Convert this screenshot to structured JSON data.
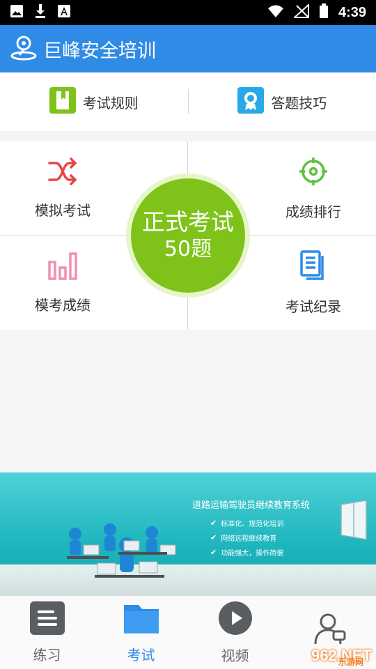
{
  "status_bar": {
    "time": "4:39",
    "icons": [
      "image-icon",
      "download-icon",
      "font-icon",
      "wifi-icon",
      "signal-off-icon",
      "battery-icon"
    ]
  },
  "app": {
    "title": "巨峰安全培训",
    "logo_icon": "location-person-icon",
    "accent_color": "#2f8be6"
  },
  "top_menu": [
    {
      "label": "考试规则",
      "icon": "book-icon",
      "color": "#7fc31a"
    },
    {
      "label": "答题技巧",
      "icon": "award-icon",
      "color": "#29a8e8"
    }
  ],
  "grid": [
    {
      "label": "模拟考试",
      "icon": "shuffle-icon",
      "color": "#e64545"
    },
    {
      "label": "成绩排行",
      "icon": "target-icon",
      "color": "#5cc23f"
    },
    {
      "label": "模考成绩",
      "icon": "bar-chart-icon",
      "color": "#f08fb2"
    },
    {
      "label": "考试纪录",
      "icon": "document-icon",
      "color": "#2f8be6"
    }
  ],
  "exam_button": {
    "title": "正式考试",
    "count": "50题",
    "color": "#7fc31a"
  },
  "banner": {
    "title": "道路运输驾驶员继续教育系统",
    "items": [
      "标准化、规范化培训",
      "网络远程继续教育",
      "功能强大，操作简便"
    ]
  },
  "tabs": [
    {
      "label": "练习",
      "icon": "list-icon",
      "active": false
    },
    {
      "label": "考试",
      "icon": "folder-icon",
      "active": true
    },
    {
      "label": "视频",
      "icon": "play-icon",
      "active": false
    },
    {
      "label": "",
      "icon": "user-icon",
      "active": false
    }
  ],
  "watermark": {
    "text": "962.NET",
    "sub": "乐游网"
  }
}
